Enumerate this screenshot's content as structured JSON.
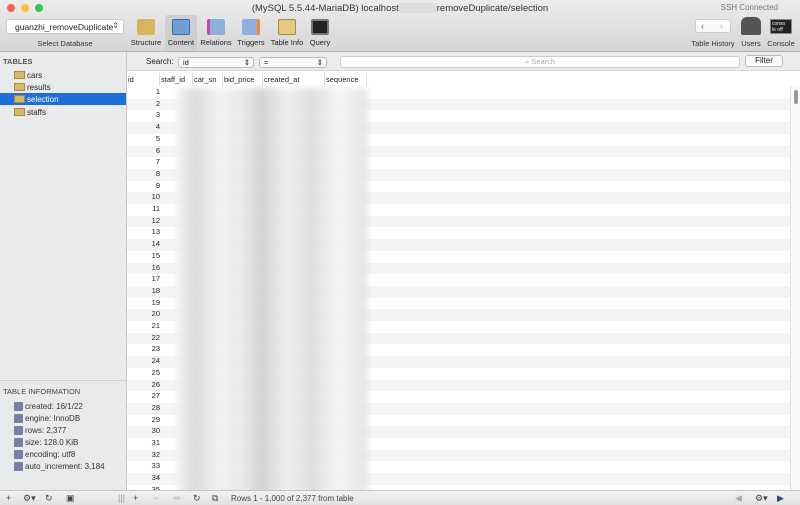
{
  "window": {
    "title_prefix": "(MySQL 5.5.44-MariaDB) localhost",
    "title_suffix": "removeDuplicate/selection",
    "status": "SSH Connected"
  },
  "toolbar": {
    "database": "guanzhi_removeDuplicate",
    "select_database_label": "Select Database",
    "buttons": [
      {
        "label": "Structure",
        "icon": "structure-icon"
      },
      {
        "label": "Content",
        "icon": "content-icon",
        "active": true
      },
      {
        "label": "Relations",
        "icon": "relations-icon"
      },
      {
        "label": "Triggers",
        "icon": "triggers-icon"
      },
      {
        "label": "Table Info",
        "icon": "table-info-icon"
      },
      {
        "label": "Query",
        "icon": "query-icon"
      }
    ],
    "table_history_label": "Table History",
    "users_label": "Users",
    "console_label": "Console",
    "console_icon_text": "conso le off"
  },
  "sidebar": {
    "tables_heading": "TABLES",
    "tables": [
      "cars",
      "results",
      "selection",
      "staffs"
    ],
    "selected": "selection",
    "info_heading": "TABLE INFORMATION",
    "info": [
      "created: 16/1/22",
      "engine: InnoDB",
      "rows: 2,377",
      "size: 128.0 KiB",
      "encoding: utf8",
      "auto_increment: 3,184"
    ]
  },
  "search": {
    "label": "Search:",
    "field": "id",
    "operator": "=",
    "placeholder": "Search",
    "filter_label": "Filter"
  },
  "grid": {
    "columns": [
      "id",
      "staff_id",
      "car_sn",
      "bid_price",
      "created_at",
      "sequence"
    ],
    "ids": [
      "1",
      "2",
      "3",
      "4",
      "5",
      "6",
      "7",
      "8",
      "9",
      "10",
      "11",
      "12",
      "13",
      "14",
      "15",
      "16",
      "17",
      "18",
      "19",
      "20",
      "21",
      "22",
      "23",
      "24",
      "25",
      "26",
      "27",
      "28",
      "29",
      "30",
      "31",
      "32",
      "33",
      "34",
      "35"
    ]
  },
  "footer": {
    "status": "Rows 1 - 1,000 of 2,377 from table"
  }
}
